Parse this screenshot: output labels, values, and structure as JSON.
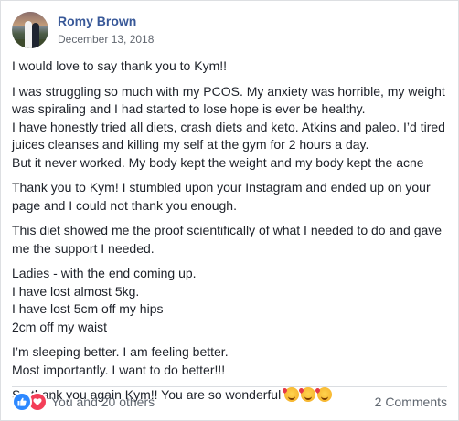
{
  "post": {
    "author": "Romy Brown",
    "date": "December 13, 2018",
    "paragraphs": [
      [
        "I would love to say thank you to Kym!!"
      ],
      [
        "I was struggling so much with my PCOS. My anxiety was horrible, my weight",
        "was spiraling and I had started to lose hope is ever be healthy.",
        "I have honestly tried all diets, crash diets and keto. Atkins and paleo. I’d tired",
        "juices cleanses and killing my self at the gym for 2 hours a day.",
        "But it never worked. My body kept the weight and my body kept the acne"
      ],
      [
        "Thank you to Kym! I stumbled upon your Instagram and ended up on your",
        "page and I could not thank you enough."
      ],
      [
        "This diet showed me the proof scientifically of what I needed to do and gave",
        "me the support I needed."
      ],
      [
        "Ladies - with the end coming up.",
        "I have lost almost 5kg.",
        "I have lost 5cm off my hips",
        "2cm off my waist"
      ],
      [
        "I’m sleeping better. I am feeling better.",
        "Most importantly. I want to do better!!!"
      ],
      [
        "So thank you again Kym!! You are so wonderful"
      ]
    ],
    "closing_emoji": "smiling-face-with-hearts-icon",
    "emoji_count": 3
  },
  "footer": {
    "reactions_text": "You and 20 others",
    "comments_text": "2 Comments",
    "reaction_icons": [
      "like-icon",
      "love-icon"
    ],
    "colors": {
      "like": "#2d88ff",
      "love": "#f33e58",
      "author_link": "#385898"
    }
  }
}
